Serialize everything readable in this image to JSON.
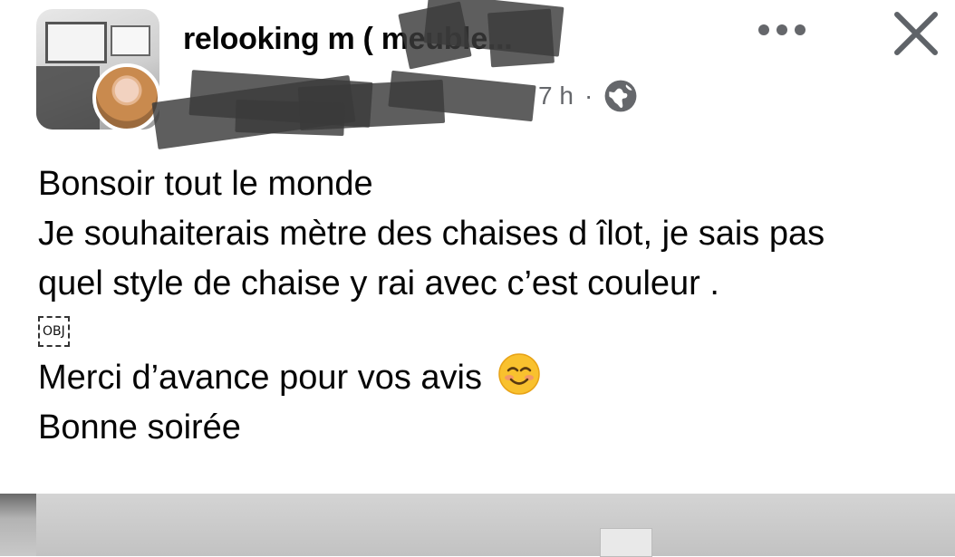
{
  "header": {
    "group_name": "relooking m  ( meuble...",
    "time_ago": "7 h",
    "separator": "·",
    "privacy_icon": "globe-icon",
    "more_icon": "more-dots-icon",
    "close_icon": "close-icon"
  },
  "post": {
    "lines": [
      "Bonsoir tout le monde",
      "Je souhaiterais mètre des chaises d îlot, je sais pas",
      "quel style de chaise y rai avec c’est couleur ."
    ],
    "object_placeholder": "OBJ",
    "thanks": "Merci d’avance pour vos avis",
    "closing": "Bonne soirée",
    "emoji": "smiling-face-icon"
  },
  "colors": {
    "text_primary": "#050505",
    "text_secondary": "#65676b",
    "background": "#ffffff"
  }
}
